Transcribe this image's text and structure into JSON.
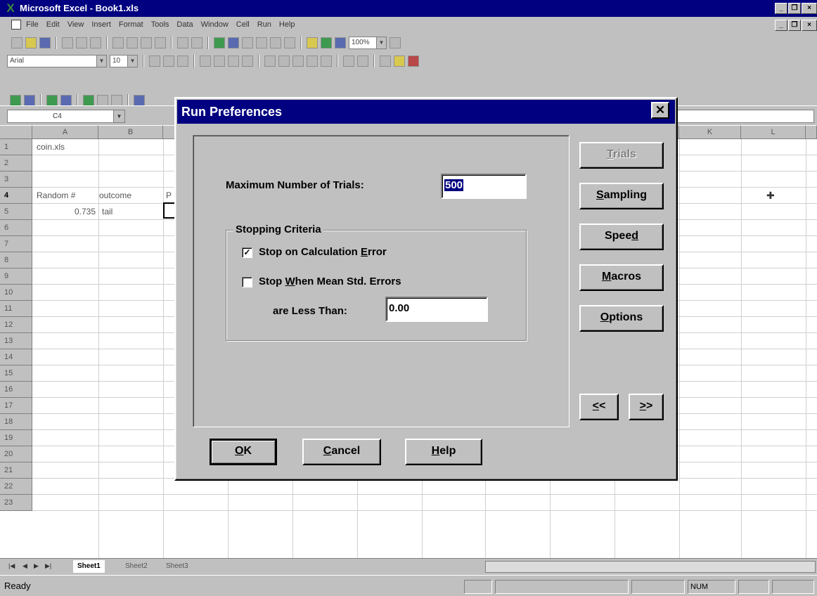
{
  "excel": {
    "title": "Microsoft Excel - Book1.xls",
    "menus": [
      "File",
      "Edit",
      "View",
      "Insert",
      "Format",
      "Tools",
      "Data",
      "Window",
      "Cell",
      "Run",
      "Help"
    ],
    "font_name": "Arial",
    "font_size": "10",
    "zoom": "100%",
    "name_box": "C4",
    "columns": [
      "A",
      "B",
      "K",
      "L"
    ],
    "rows": [
      "1",
      "2",
      "3",
      "4",
      "5",
      "6",
      "7",
      "8",
      "9",
      "10",
      "11",
      "12",
      "13",
      "14",
      "15",
      "16",
      "17",
      "18",
      "19",
      "20",
      "21",
      "22",
      "23"
    ],
    "cells": {
      "A1": "coin.xls",
      "A3": "Random #",
      "B3": "outcome",
      "C3": "P",
      "A4": "0.735",
      "B4": "tail"
    },
    "sheet_tabs": [
      "Sheet1",
      "Sheet2",
      "Sheet3"
    ],
    "status": {
      "ready": "Ready",
      "num": "NUM"
    }
  },
  "dialog": {
    "title": "Run Preferences",
    "max_trials_label": "Maximum Number of Trials:",
    "max_trials_value": "500",
    "stopping_criteria": {
      "title": "Stopping Criteria",
      "stop_on_error": {
        "checked": true
      },
      "stop_when_mean": {
        "checked": false
      },
      "less_than_label": "are Less Than:",
      "less_than_value": "0.00"
    }
  }
}
